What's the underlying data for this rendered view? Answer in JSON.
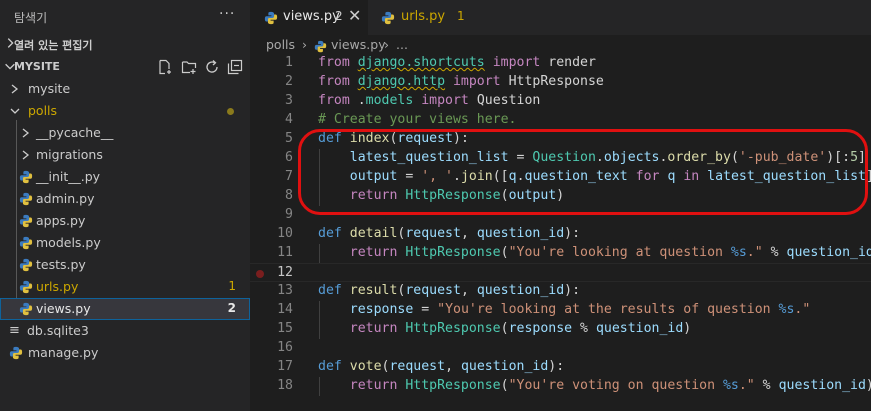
{
  "sidebar": {
    "title": "탐색기",
    "more": "···",
    "open_editors": "열려 있는 편집기",
    "workspace": "MYSITE",
    "items": [
      {
        "label": "mysite",
        "kind": "folder",
        "color": "#cccccc"
      },
      {
        "label": "polls",
        "kind": "folder-open",
        "color": "#cca700"
      },
      {
        "label": "__pycache__",
        "kind": "folder",
        "color": "#cccccc"
      },
      {
        "label": "migrations",
        "kind": "folder",
        "color": "#cccccc"
      },
      {
        "label": "__init__.py",
        "kind": "py",
        "color": "#cccccc"
      },
      {
        "label": "admin.py",
        "kind": "py",
        "color": "#cccccc"
      },
      {
        "label": "apps.py",
        "kind": "py",
        "color": "#cccccc"
      },
      {
        "label": "models.py",
        "kind": "py",
        "color": "#cccccc"
      },
      {
        "label": "tests.py",
        "kind": "py",
        "color": "#cccccc"
      },
      {
        "label": "urls.py",
        "kind": "py",
        "color": "#cca700",
        "badge": "1"
      },
      {
        "label": "views.py",
        "kind": "py",
        "color": "#e8e8e8",
        "badge": "2",
        "selected": true
      },
      {
        "label": "db.sqlite3",
        "kind": "db",
        "color": "#cccccc"
      },
      {
        "label": "manage.py",
        "kind": "py",
        "color": "#cccccc"
      }
    ]
  },
  "tabs": [
    {
      "label": "views.py",
      "badge": "2",
      "close": "✕",
      "active": true
    },
    {
      "label": "urls.py",
      "badge": "1",
      "active": false
    }
  ],
  "breadcrumb": {
    "folder": "polls",
    "sep": "›",
    "file": "views.py",
    "tail": "..."
  },
  "code": {
    "lines": [
      {
        "n": "1",
        "tokens": [
          [
            "kw2",
            "from "
          ],
          [
            "mod",
            "django.shortcuts"
          ],
          [
            "kw2",
            " import "
          ],
          [
            "plain",
            "render"
          ]
        ]
      },
      {
        "n": "2",
        "tokens": [
          [
            "kw2",
            "from "
          ],
          [
            "mod",
            "django.http"
          ],
          [
            "kw2",
            " import "
          ],
          [
            "plain",
            "HttpResponse"
          ]
        ]
      },
      {
        "n": "3",
        "tokens": [
          [
            "kw2",
            "from "
          ],
          [
            "plain",
            "."
          ],
          [
            "mod2",
            "models"
          ],
          [
            "kw2",
            " import "
          ],
          [
            "plain",
            "Question"
          ]
        ]
      },
      {
        "n": "4",
        "tokens": [
          [
            "com",
            "# Create your views here."
          ]
        ]
      },
      {
        "n": "5",
        "tokens": [
          [
            "kw",
            "def "
          ],
          [
            "fn",
            "index"
          ],
          [
            "plain",
            "("
          ],
          [
            "var",
            "request"
          ],
          [
            "plain",
            "):"
          ]
        ]
      },
      {
        "n": "6",
        "tokens": [
          [
            "plain",
            "    "
          ],
          [
            "var",
            "latest_question_list"
          ],
          [
            "plain",
            " = "
          ],
          [
            "cls",
            "Question"
          ],
          [
            "plain",
            "."
          ],
          [
            "var",
            "objects"
          ],
          [
            "plain",
            "."
          ],
          [
            "fn",
            "order_by"
          ],
          [
            "plain",
            "("
          ],
          [
            "str",
            "'-pub_date'"
          ],
          [
            "plain",
            ")[:"
          ],
          [
            "num",
            "5"
          ],
          [
            "plain",
            "]"
          ]
        ]
      },
      {
        "n": "7",
        "tokens": [
          [
            "plain",
            "    "
          ],
          [
            "var",
            "output"
          ],
          [
            "plain",
            " = "
          ],
          [
            "str",
            "', '"
          ],
          [
            "plain",
            "."
          ],
          [
            "fn",
            "join"
          ],
          [
            "plain",
            "(["
          ],
          [
            "var",
            "q"
          ],
          [
            "plain",
            "."
          ],
          [
            "var",
            "question_text"
          ],
          [
            "ctrl",
            " for "
          ],
          [
            "var",
            "q"
          ],
          [
            "ctrl",
            " in "
          ],
          [
            "var",
            "latest_question_list"
          ],
          [
            "plain",
            "])"
          ]
        ]
      },
      {
        "n": "8",
        "tokens": [
          [
            "plain",
            "    "
          ],
          [
            "ctrl",
            "return "
          ],
          [
            "cls",
            "HttpResponse"
          ],
          [
            "plain",
            "("
          ],
          [
            "var",
            "output"
          ],
          [
            "plain",
            ")"
          ]
        ]
      },
      {
        "n": "9",
        "tokens": []
      },
      {
        "n": "10",
        "tokens": [
          [
            "kw",
            "def "
          ],
          [
            "fn",
            "detail"
          ],
          [
            "plain",
            "("
          ],
          [
            "var",
            "request"
          ],
          [
            "plain",
            ", "
          ],
          [
            "var",
            "question_id"
          ],
          [
            "plain",
            "):"
          ]
        ]
      },
      {
        "n": "11",
        "tokens": [
          [
            "plain",
            "    "
          ],
          [
            "ctrl",
            "return "
          ],
          [
            "cls",
            "HttpResponse"
          ],
          [
            "plain",
            "("
          ],
          [
            "str",
            "\"You're looking at question "
          ],
          [
            "fmt",
            "%s"
          ],
          [
            "str",
            ".\""
          ],
          [
            "plain",
            " % "
          ],
          [
            "var",
            "question_id"
          ],
          [
            "plain",
            ")"
          ]
        ]
      },
      {
        "n": "12",
        "tokens": [],
        "current": true,
        "breakpoint": true
      },
      {
        "n": "13",
        "tokens": [
          [
            "kw",
            "def "
          ],
          [
            "fn",
            "result"
          ],
          [
            "plain",
            "("
          ],
          [
            "var",
            "request"
          ],
          [
            "plain",
            ", "
          ],
          [
            "var",
            "question_id"
          ],
          [
            "plain",
            "):"
          ]
        ]
      },
      {
        "n": "14",
        "tokens": [
          [
            "plain",
            "    "
          ],
          [
            "var",
            "response"
          ],
          [
            "plain",
            " = "
          ],
          [
            "str",
            "\"You're looking at the results of question "
          ],
          [
            "fmt",
            "%s"
          ],
          [
            "str",
            ".\""
          ]
        ]
      },
      {
        "n": "15",
        "tokens": [
          [
            "plain",
            "    "
          ],
          [
            "ctrl",
            "return "
          ],
          [
            "cls",
            "HttpResponse"
          ],
          [
            "plain",
            "("
          ],
          [
            "var",
            "response"
          ],
          [
            "plain",
            " % "
          ],
          [
            "var",
            "question_id"
          ],
          [
            "plain",
            ")"
          ]
        ]
      },
      {
        "n": "16",
        "tokens": []
      },
      {
        "n": "17",
        "tokens": [
          [
            "kw",
            "def "
          ],
          [
            "fn",
            "vote"
          ],
          [
            "plain",
            "("
          ],
          [
            "var",
            "request"
          ],
          [
            "plain",
            ", "
          ],
          [
            "var",
            "question_id"
          ],
          [
            "plain",
            "):"
          ]
        ]
      },
      {
        "n": "18",
        "tokens": [
          [
            "plain",
            "    "
          ],
          [
            "ctrl",
            "return "
          ],
          [
            "cls",
            "HttpResponse"
          ],
          [
            "plain",
            "("
          ],
          [
            "str",
            "\"You're voting on question "
          ],
          [
            "fmt",
            "%s"
          ],
          [
            "str",
            ".\""
          ],
          [
            "plain",
            " % "
          ],
          [
            "var",
            "question_id"
          ],
          [
            "plain",
            ")"
          ]
        ]
      }
    ]
  },
  "colors": {
    "accent": "#0e639c",
    "warning": "#cca700",
    "highlight": "#e01010"
  }
}
